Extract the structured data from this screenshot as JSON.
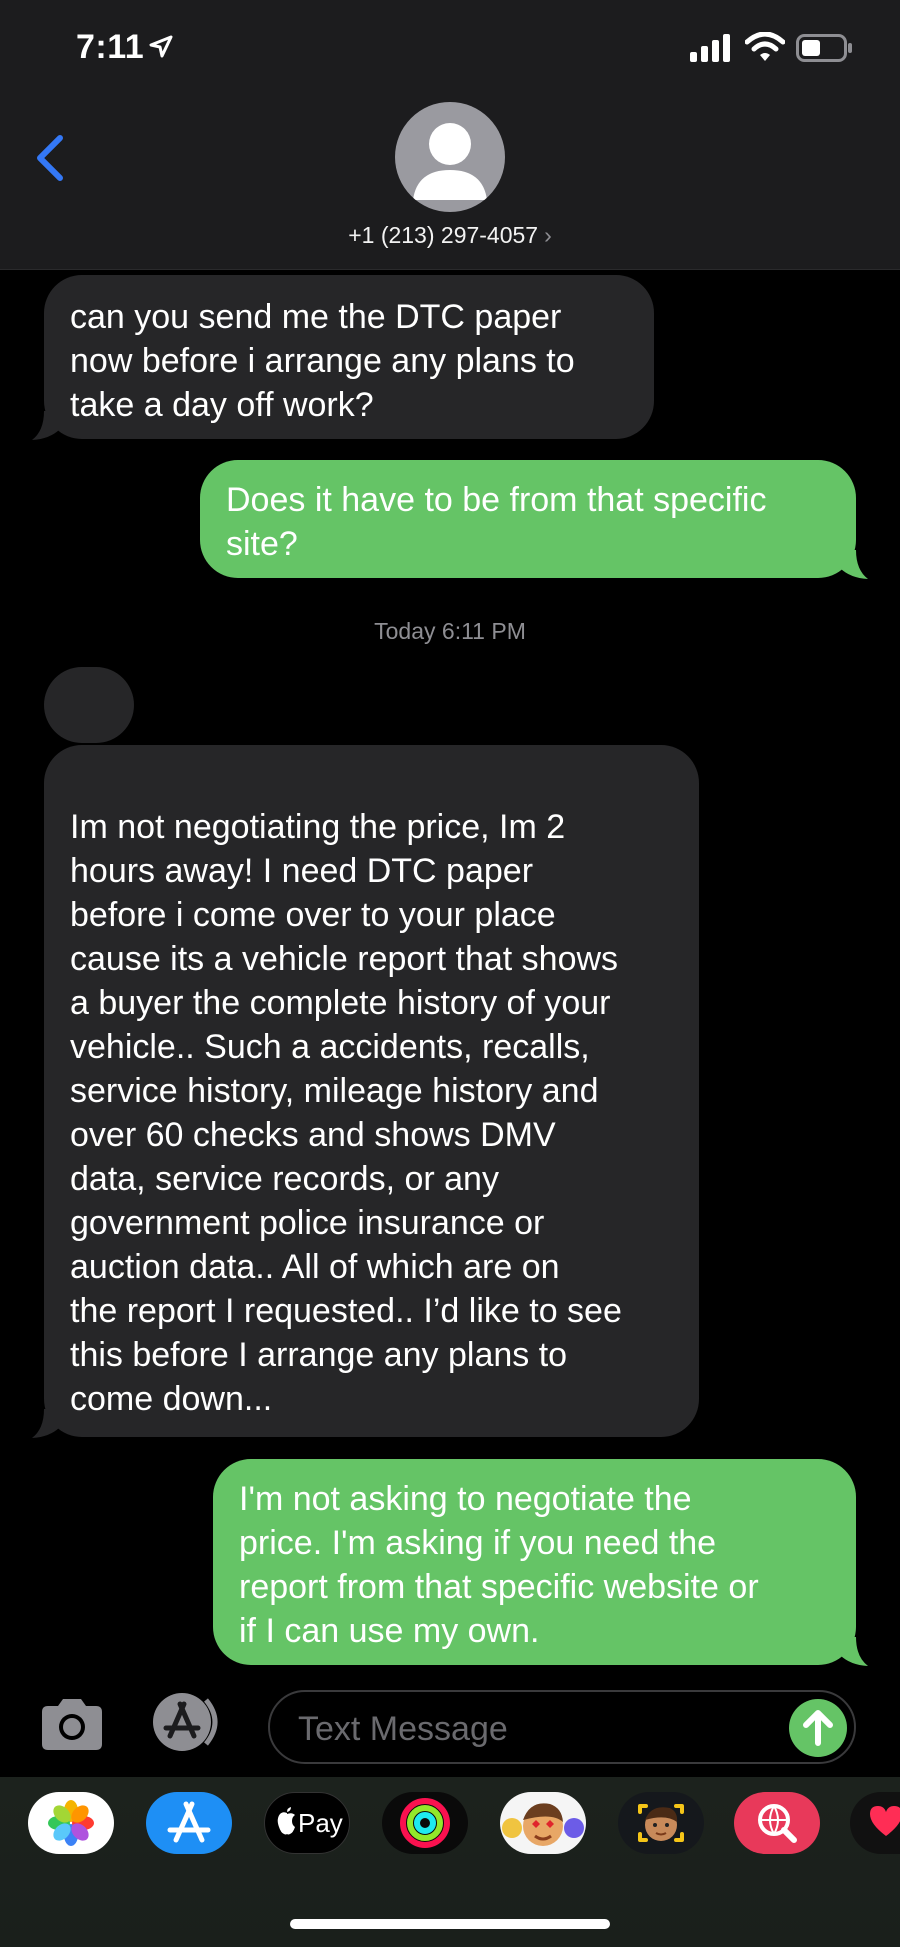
{
  "status_bar": {
    "time": "7:11"
  },
  "header": {
    "contact": "+1 (213) 297-4057",
    "chevron": "›"
  },
  "messages": [
    {
      "side": "received",
      "lines": [
        "can you send me the DTC paper",
        "now before i arrange any plans to",
        "take a day off work?"
      ]
    },
    {
      "side": "sent",
      "lines": [
        "Does it have to be from that specific",
        "site?"
      ]
    },
    {
      "side": "received",
      "lines": [
        "Im not negotiating the price, Im 2",
        "hours away! I need DTC paper",
        "before i come over to your place",
        "cause its a vehicle report that shows",
        "a buyer the complete history of your",
        "vehicle.. Such a accidents, recalls,",
        "service history, mileage history and",
        "over 60 checks and shows DMV",
        "data, service records, or any",
        "government police insurance or",
        "auction data..  All of which are on",
        "the report I requested.. I’d like to see",
        "this before I arrange any plans to",
        "come down..."
      ]
    },
    {
      "side": "sent",
      "lines": [
        "I'm not asking to negotiate the",
        "price. I'm asking if you need the",
        "report from that specific website or",
        "if I can use my own."
      ]
    }
  ],
  "timestamp": "Today 6:11 PM",
  "input": {
    "placeholder": "Text Message"
  },
  "app_drawer": {
    "applepay_label": "Pay",
    "icons": [
      "photos-icon",
      "app-store-icon",
      "apple-pay-icon",
      "activity-icon",
      "memoji-icon",
      "memoji-stickers-icon",
      "web-search-icon",
      "digital-touch-icon"
    ]
  },
  "colors": {
    "sent_bubble": "#65c466",
    "received_bubble": "#262628",
    "accent": "#3478f6"
  }
}
